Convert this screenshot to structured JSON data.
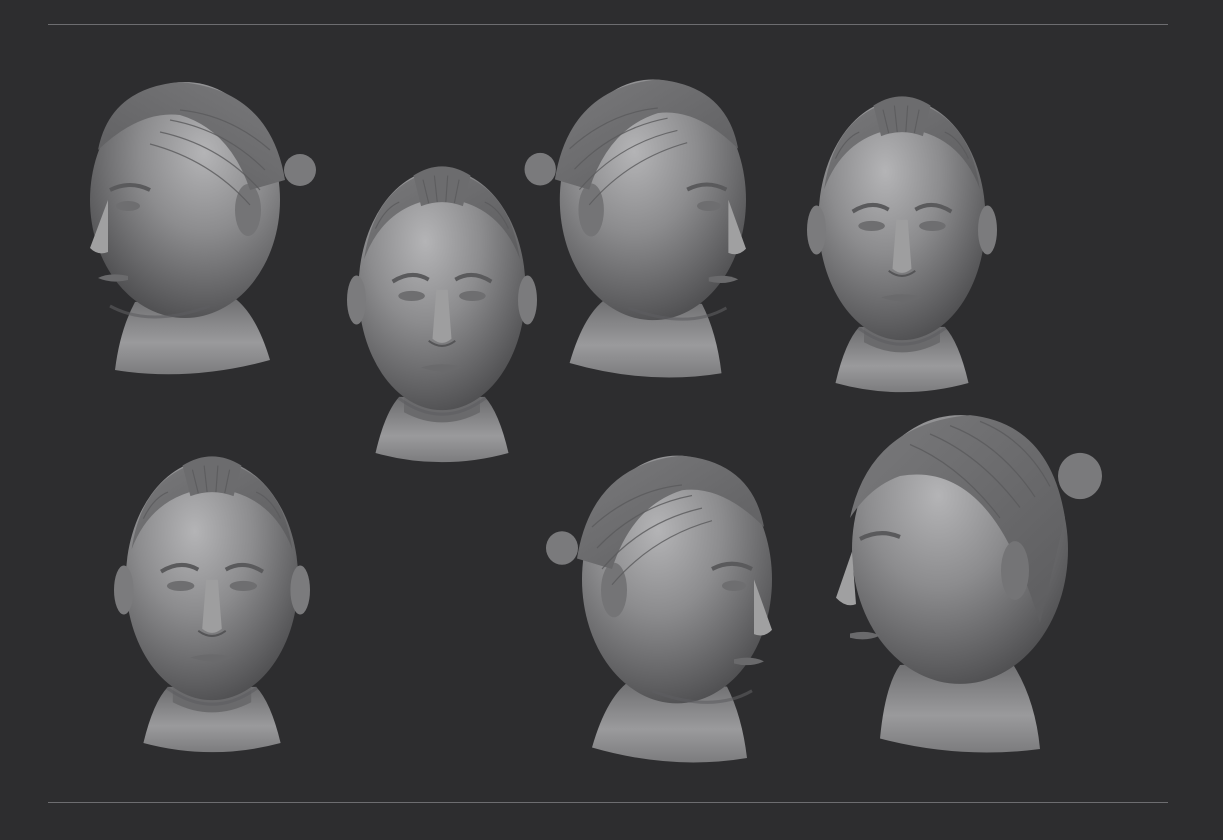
{
  "image": {
    "subject": "",
    "background_color": "#2d2d2f",
    "rule_color": "#6d6d70",
    "clay_color": "#8a8a8c"
  },
  "heads": [
    {
      "view": "three-quarter-left-up"
    },
    {
      "view": "front"
    },
    {
      "view": "three-quarter-right"
    },
    {
      "view": "front"
    },
    {
      "view": "front"
    },
    {
      "view": "three-quarter-right-down"
    },
    {
      "view": "profile-left"
    }
  ]
}
